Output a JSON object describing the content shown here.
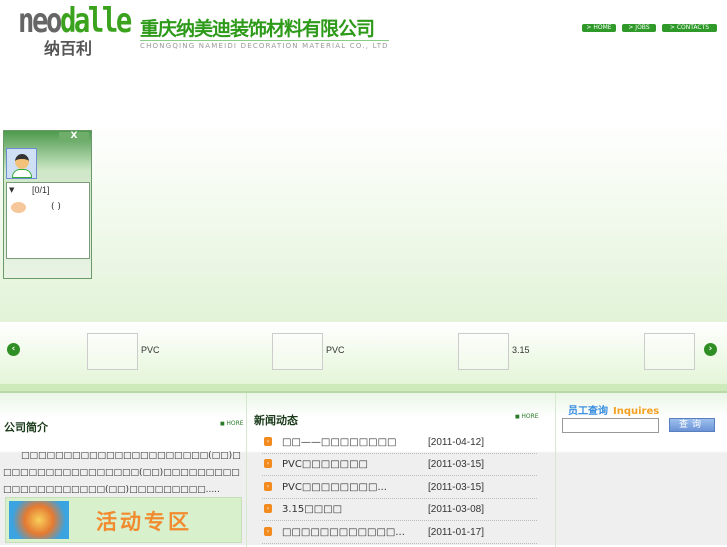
{
  "header": {
    "logo_en_a": "neo",
    "logo_en_b": "dalle",
    "logo_cn": "纳百利",
    "company_name": "重庆纳美迪装饰材料有限公司",
    "company_name_en": "CHONGQING NAMEIDI DECORATION MATERIAL CO., LTD",
    "nav": [
      {
        "label": "> HOME"
      },
      {
        "label": "> JOBS"
      },
      {
        "label": "> CONTACTS"
      }
    ]
  },
  "chat_widget": {
    "close_label": "X",
    "group_label": "[0/1]",
    "contact_label": "( )"
  },
  "slider": {
    "items": [
      {
        "label": "PVC"
      },
      {
        "label": "PVC"
      },
      {
        "label": "3.15"
      },
      {
        "label": ""
      }
    ],
    "prev": "‹",
    "next": "›"
  },
  "about": {
    "title": "公司简介",
    "more": "HORE",
    "text": "□□□□□□□□□□□□□□□□□□□□□□(□□)□□□□□□□□□□□□□□□□□(□□)□□□□□□□□□□□□□□□□□□□□□(□□)□□□□□□□□□.....",
    "banner": "活动专区"
  },
  "news": {
    "title": "新闻动态",
    "more": "HORE",
    "items": [
      {
        "title": "□□——□□□□□□□□",
        "date": "[2011-04-12]"
      },
      {
        "title": "PVC□□□□□□□",
        "date": "[2011-03-15]"
      },
      {
        "title": "PVC□□□□□□□□...",
        "date": "[2011-03-15]"
      },
      {
        "title": "3.15□□□□",
        "date": "[2011-03-08]"
      },
      {
        "title": "□□□□□□□□□□□□...",
        "date": "[2011-01-17]"
      }
    ]
  },
  "inquiry": {
    "title_cn": "员工查询",
    "title_en": "Inquires",
    "input_value": "",
    "button": "查询"
  }
}
